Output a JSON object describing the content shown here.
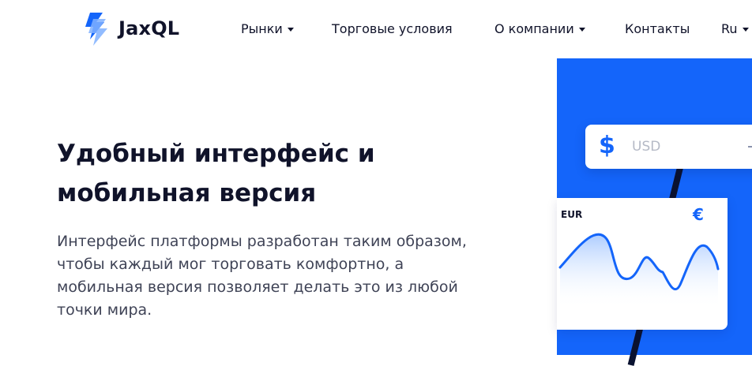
{
  "brand": {
    "name": "JaxQL",
    "accent_color": "#1465FA"
  },
  "nav": {
    "markets": "Рынки",
    "trading_conditions": "Торговые условия",
    "about": "О компании",
    "contacts": "Контакты",
    "language": "Ru"
  },
  "hero": {
    "title_line1": "Удобный интерфейс и",
    "title_line2": "мобильная версия",
    "description_line1": "Интерфейс платформы разработан таким образом,",
    "description_line2": "чтобы каждый мог торговать комфортно, а",
    "description_line3": "мобильная версия позволяет делать это из любой",
    "description_line4": "точки мира."
  },
  "widget": {
    "usd_symbol": "$",
    "usd_label": "USD",
    "eur_label": "EUR",
    "eur_symbol": "€"
  },
  "icons": {
    "dropdown": "caret-down-icon",
    "usd": "dollar-icon",
    "eur": "euro-icon"
  }
}
